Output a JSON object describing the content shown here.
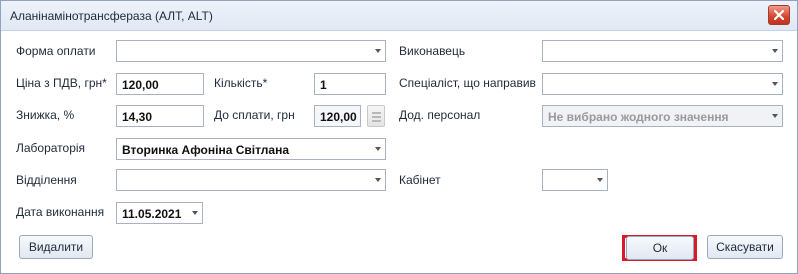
{
  "window": {
    "title": "Аланінамінотрансфераза (АЛТ, ALT)"
  },
  "form": {
    "payment_form": {
      "label": "Форма оплати",
      "value": ""
    },
    "executor": {
      "label": "Виконавець",
      "value": ""
    },
    "price": {
      "label": "Ціна з ПДВ, грн*",
      "value": "120,00"
    },
    "quantity": {
      "label": "Кількість*",
      "value": "1"
    },
    "referring_specialist": {
      "label": "Спеціаліст, що направив",
      "value": ""
    },
    "discount": {
      "label": "Знижка, %",
      "value": "14,30"
    },
    "to_pay": {
      "label": "До сплати, грн",
      "value": "120,00"
    },
    "additional_staff": {
      "label": "Дод. персонал",
      "placeholder": "Не вибрано жодного значення"
    },
    "laboratory": {
      "label": "Лабораторія",
      "value": "Вторинка Афоніна Світлана"
    },
    "department": {
      "label": "Відділення",
      "value": ""
    },
    "cabinet": {
      "label": "Кабінет",
      "value": ""
    },
    "execution_date": {
      "label": "Дата виконання",
      "value": "11.05.2021"
    }
  },
  "buttons": {
    "delete": "Видалити",
    "ok": "Ок",
    "cancel": "Скасувати"
  },
  "icons": {
    "close": "close-icon",
    "calculator": "calculator-icon",
    "dropdown": "chevron-down-icon"
  },
  "colors": {
    "highlight": "#d81b28",
    "close_button": "#d2452f"
  }
}
